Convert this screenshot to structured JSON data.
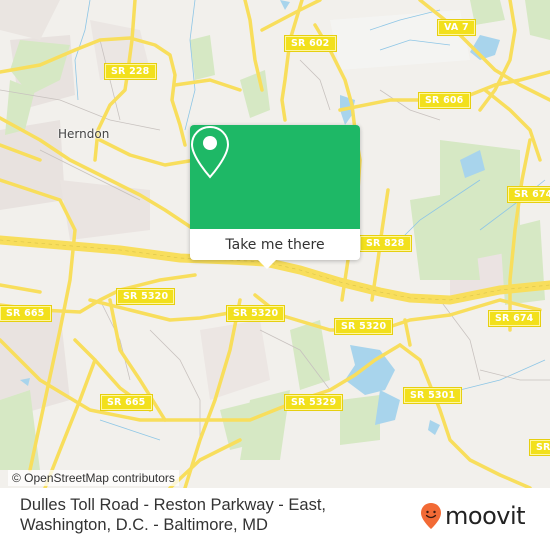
{
  "map": {
    "town_labels": [
      {
        "name": "Herndon"
      }
    ],
    "road_labels": [
      {
        "id": "sr228",
        "text": "SR 228"
      },
      {
        "id": "sr602",
        "text": "SR 602"
      },
      {
        "id": "va7",
        "text": "VA 7"
      },
      {
        "id": "sr606",
        "text": "SR 606"
      },
      {
        "id": "sr674a",
        "text": "SR 674"
      },
      {
        "id": "sr828",
        "text": "SR 828"
      },
      {
        "id": "sr5320a",
        "text": "SR 5320"
      },
      {
        "id": "sr665a",
        "text": "SR 665"
      },
      {
        "id": "sr5320b",
        "text": "SR 5320"
      },
      {
        "id": "sr5320c",
        "text": "SR 5320"
      },
      {
        "id": "sr674b",
        "text": "SR 674"
      },
      {
        "id": "sr665b",
        "text": "SR 665"
      },
      {
        "id": "sr5329",
        "text": "SR 5329"
      },
      {
        "id": "sr5301",
        "text": "SR 5301"
      },
      {
        "id": "sr_edge",
        "text": "SR"
      }
    ],
    "attribution": "© OpenStreetMap contributors"
  },
  "popup": {
    "icon": "map-pin-icon",
    "button_label": "Take me there",
    "color": "#1eb866"
  },
  "footer": {
    "address_line1": "Dulles Toll Road - Reston Parkway - East,",
    "address_line2": "Washington, D.C. - Baltimore, MD",
    "brand": "moovit",
    "brand_color": "#f26a35"
  }
}
